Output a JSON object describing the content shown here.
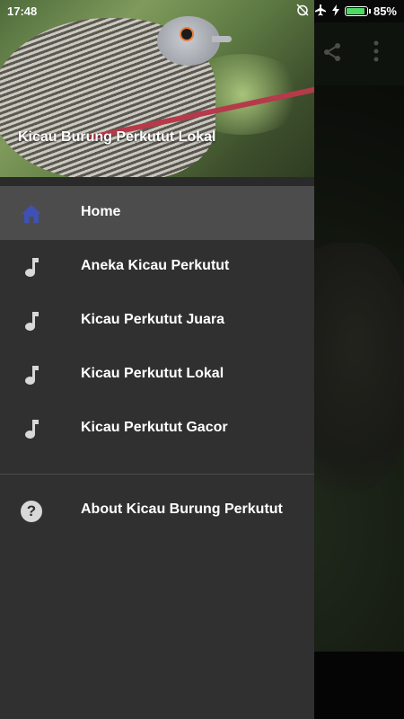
{
  "status_bar": {
    "time": "17:48",
    "battery": "85%"
  },
  "header": {
    "title": "Kicau Burung Perkutut Lokal"
  },
  "menu": {
    "items": [
      {
        "label": "Home",
        "icon": "home-icon",
        "active": true
      },
      {
        "label": "Aneka Kicau Perkutut",
        "icon": "music-note-icon"
      },
      {
        "label": "Kicau Perkutut Juara",
        "icon": "music-note-icon"
      },
      {
        "label": "Kicau Perkutut Lokal",
        "icon": "music-note-icon"
      },
      {
        "label": "Kicau Perkutut Gacor",
        "icon": "music-note-icon"
      }
    ],
    "about": {
      "label": "About Kicau Burung Perkutut",
      "icon": "help-circle-icon"
    }
  },
  "colors": {
    "accent": "#3f51b5",
    "drawer_bg": "#303030",
    "active_bg": "#4c4c4c"
  }
}
